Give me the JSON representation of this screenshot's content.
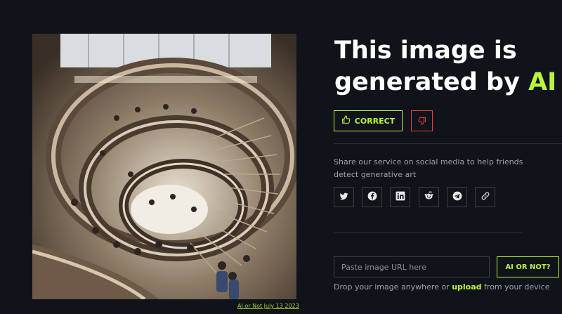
{
  "image": {
    "alt_subject": "spiral-staircase-illustration",
    "caption": "AI or Not July 13 2023"
  },
  "result": {
    "headline_prefix": "This image is generated by ",
    "headline_accent": "AI",
    "accent_color": "#b9f53d"
  },
  "feedback": {
    "correct_label": "CORRECT",
    "correct_icon": "thumbs-up-icon",
    "incorrect_icon": "thumbs-down-icon",
    "incorrect_color": "#e8423c"
  },
  "share": {
    "text": "Share our service on social media to help friends detect generative art",
    "networks": [
      "twitter-icon",
      "facebook-icon",
      "linkedin-icon",
      "reddit-icon",
      "telegram-icon",
      "link-icon"
    ]
  },
  "check": {
    "placeholder": "Paste image URL here",
    "button_label": "AI OR NOT?",
    "drop_prefix": "Drop your image anywhere or ",
    "drop_link": "upload",
    "drop_suffix": " from your device"
  }
}
